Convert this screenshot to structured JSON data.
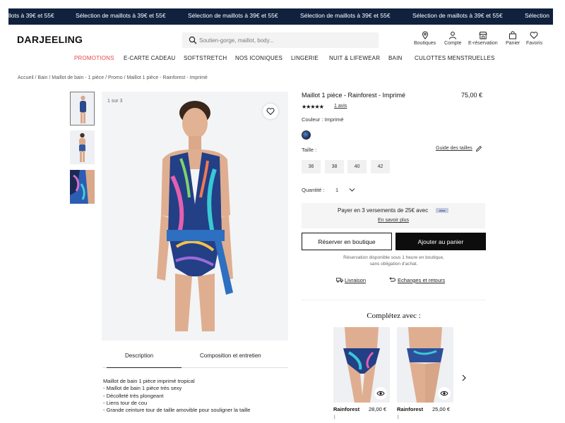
{
  "promo_band": {
    "items": [
      "llots à 39€ et 55€",
      "Sélection de maillots à 39€ et 55€",
      "Sélection de maillots à 39€ et 55€",
      "Sélection de maillots à 39€ et 55€",
      "Sélection de maillots à 39€ et 55€",
      "Sélection"
    ],
    "background": "#10213e"
  },
  "header": {
    "logo": "DARJEELING",
    "search": {
      "placeholder": "Soutien-gorge, maillot, body..."
    },
    "icons": [
      {
        "label": "Boutiques",
        "icon": "map-pin-icon"
      },
      {
        "label": "Compte",
        "icon": "user-icon"
      },
      {
        "label": "E-réservation",
        "icon": "store-icon"
      },
      {
        "label": "Panier",
        "icon": "bag-icon"
      },
      {
        "label": "Favoris",
        "icon": "heart-icon"
      }
    ]
  },
  "nav": {
    "items": [
      "PROMOTIONS",
      "E-CARTE CADEAU",
      "SOFTSTRETCH",
      "NOS ICONIQUES",
      "LINGERIE",
      "NUIT & LIFEWEAR",
      "BAIN",
      "CULOTTES MENSTRUELLES"
    ],
    "promo_color": "#e5474a"
  },
  "breadcrumb": "Accueil / Bain / Maillot de bain - 1 pièce / Promo / Maillot 1 pièce - Rainforest - Imprimé",
  "gallery": {
    "counter": "1 sur 3",
    "thumbnail_count": 3
  },
  "tabs": {
    "description": "Description",
    "composition": "Composition et entretien"
  },
  "description_lines": [
    "Maillot de bain 1 pièce imprimé tropical",
    "- Maillot de bain 1 pièce très sexy",
    "- Décolleté très plongeant",
    "- Liens tour de cou",
    "- Grande ceinture tour de taille amovible pour souligner la taille"
  ],
  "product": {
    "title": "Maillot 1 pièce - Rainforest - Imprimé",
    "price": "75,00 €",
    "stars": "★★★★★",
    "reviews": "1 avis",
    "color_label": "Couleur : Imprimé",
    "size_label": "Taille :",
    "size_guide": "Guide des tailles",
    "sizes": [
      "36",
      "38",
      "40",
      "42"
    ],
    "quantity_label": "Quantité :",
    "quantity_value": "1",
    "payment": {
      "text": "Payer en 3 versements de 25€ avec",
      "badge": "alma",
      "link": "En savoir plus"
    },
    "reserve_button": "Réserver en boutique",
    "cart_button": "Ajouter au panier",
    "reservation_note_1": "Réservation disponible sous 1 heure en boutique,",
    "reservation_note_2": "sans obligation d'achat.",
    "delivery": "Livraison",
    "returns": "Echanges et retours"
  },
  "complete_section": {
    "title": "Complétez avec :",
    "items": [
      {
        "name": "Rainforest",
        "price": "28,00 €",
        "sub": "|"
      },
      {
        "name": "Rainforest",
        "price": "25,00 €",
        "sub": "|"
      }
    ]
  }
}
